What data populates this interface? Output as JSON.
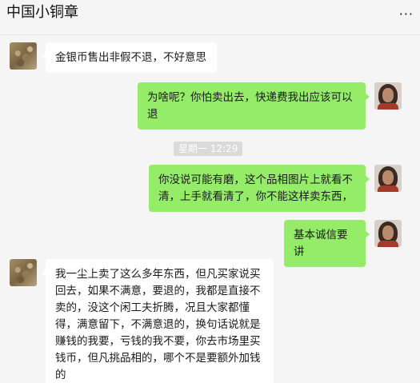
{
  "window": {
    "title": "中国小铜章",
    "more_label": "···"
  },
  "messages": [
    {
      "side": "in",
      "text": "金银币售出非假不退，不好意思"
    },
    {
      "side": "out",
      "text": "为啥呢？你怕卖出去，快递费我出应该可以退"
    },
    {
      "side": "out",
      "text": "你没说可能有磨，这个品相图片上就看不清，上手就看清了，你不能这样卖东西，"
    },
    {
      "side": "out",
      "text": "基本诚信要讲"
    },
    {
      "side": "in",
      "text": "我一尘上卖了这么多年东西，但凡买家说买回去，如果不满意，要退的，我都是直接不卖的，没这个闲工夫折腾，况且大家都懂得，满意留下，不满意退的，换句话说就是赚钱的我要，亏钱的我不要，你去市场里买钱币，但凡挑品相的，哪个不是要额外加钱的"
    }
  ],
  "timestamp": "星期一 12:29",
  "avatars": {
    "left_icon": "dealer-avatar",
    "right_icon": "user-avatar"
  },
  "colors": {
    "incoming_bubble": "#ffffff",
    "outgoing_bubble": "#95ec69",
    "background": "#f5f5f5"
  }
}
